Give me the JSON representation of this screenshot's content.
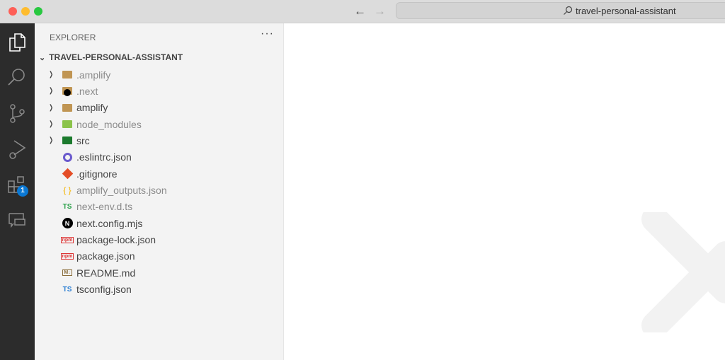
{
  "titlebar": {
    "search_text": "travel-personal-assistant"
  },
  "activity_bar": {
    "extensions_badge": "1"
  },
  "sidebar": {
    "header": "EXPLORER",
    "more": "···",
    "root": "TRAVEL-PERSONAL-ASSISTANT",
    "items": [
      {
        "label": ".amplify",
        "type": "folder",
        "icon": "folder-icon",
        "dim": true
      },
      {
        "label": ".next",
        "type": "folder",
        "icon": "next-folder-icon",
        "dim": true
      },
      {
        "label": "amplify",
        "type": "folder",
        "icon": "folder-icon",
        "dim": false
      },
      {
        "label": "node_modules",
        "type": "folder",
        "icon": "node-folder-icon",
        "dim": true
      },
      {
        "label": "src",
        "type": "folder",
        "icon": "src-folder-icon",
        "dim": false
      },
      {
        "label": ".eslintrc.json",
        "type": "file",
        "icon": "eslint-icon",
        "dim": false
      },
      {
        "label": ".gitignore",
        "type": "file",
        "icon": "git-icon",
        "dim": false
      },
      {
        "label": "amplify_outputs.json",
        "type": "file",
        "icon": "json-icon",
        "glyph": "{ }",
        "dim": true
      },
      {
        "label": "next-env.d.ts",
        "type": "file",
        "icon": "typescript-icon",
        "glyph": "TS",
        "dim": true
      },
      {
        "label": "next.config.mjs",
        "type": "file",
        "icon": "nextjs-icon",
        "glyph": "N",
        "dim": false
      },
      {
        "label": "package-lock.json",
        "type": "file",
        "icon": "npm-icon",
        "glyph": "npm",
        "dim": false
      },
      {
        "label": "package.json",
        "type": "file",
        "icon": "npm-icon",
        "glyph": "npm",
        "dim": false
      },
      {
        "label": "README.md",
        "type": "file",
        "icon": "markdown-icon",
        "glyph": "M↓",
        "dim": false
      },
      {
        "label": "tsconfig.json",
        "type": "file",
        "icon": "tsconfig-icon",
        "glyph": "TS",
        "dim": false
      }
    ]
  },
  "colors": {
    "accent": "#0a78d4",
    "folder": "#c09553"
  }
}
